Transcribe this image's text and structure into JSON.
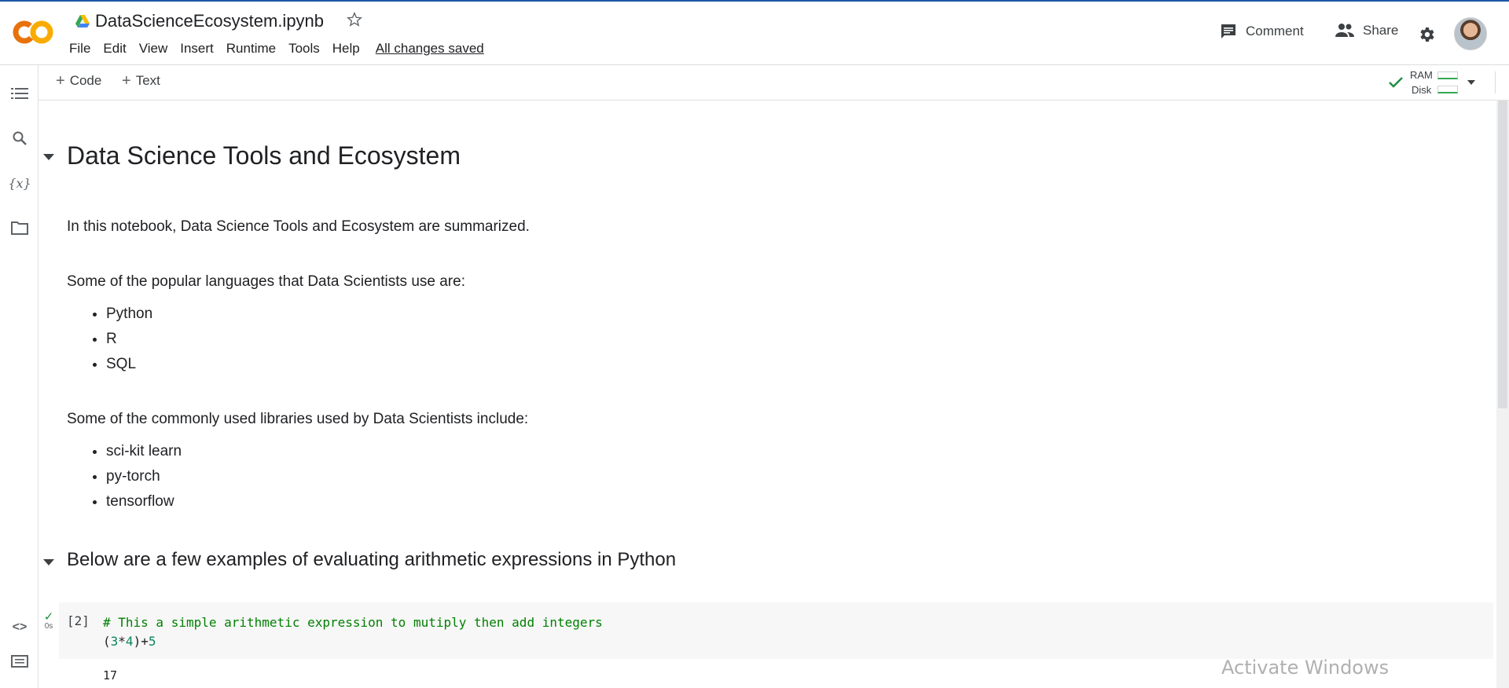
{
  "header": {
    "title": "DataScienceEcosystem.ipynb",
    "menu": [
      "File",
      "Edit",
      "View",
      "Insert",
      "Runtime",
      "Tools",
      "Help"
    ],
    "saved_status": "All changes saved",
    "comment_label": "Comment",
    "share_label": "Share"
  },
  "toolbar": {
    "add_code": "Code",
    "add_text": "Text",
    "ram_label": "RAM",
    "disk_label": "Disk"
  },
  "notebook": {
    "heading1": "Data Science Tools and Ecosystem",
    "intro": "In this notebook, Data Science Tools and Ecosystem are summarized.",
    "languages_intro": "Some of the popular languages that Data Scientists use are:",
    "languages": [
      "Python",
      "R",
      "SQL"
    ],
    "libraries_intro": "Some of the commonly used libraries used by Data Scientists include:",
    "libraries": [
      "sci-kit learn",
      "py-torch",
      "tensorflow"
    ],
    "heading2": "Below are a few examples of evaluating arithmetic expressions in Python",
    "cell": {
      "exec_count": "[2]",
      "exec_time": "0s",
      "comment": "# This a simple arithmetic expression to mutiply then add integers",
      "code_open": "(",
      "code_a": "3",
      "code_mul": "*",
      "code_b": "4",
      "code_close": ")+",
      "code_c": "5",
      "output": "17"
    }
  },
  "watermark": "Activate Windows",
  "colors": {
    "accent": "#1a57a6",
    "ok": "#1e8e3e",
    "logo_orange": "#f9ab00",
    "logo_deep": "#e8710a"
  }
}
